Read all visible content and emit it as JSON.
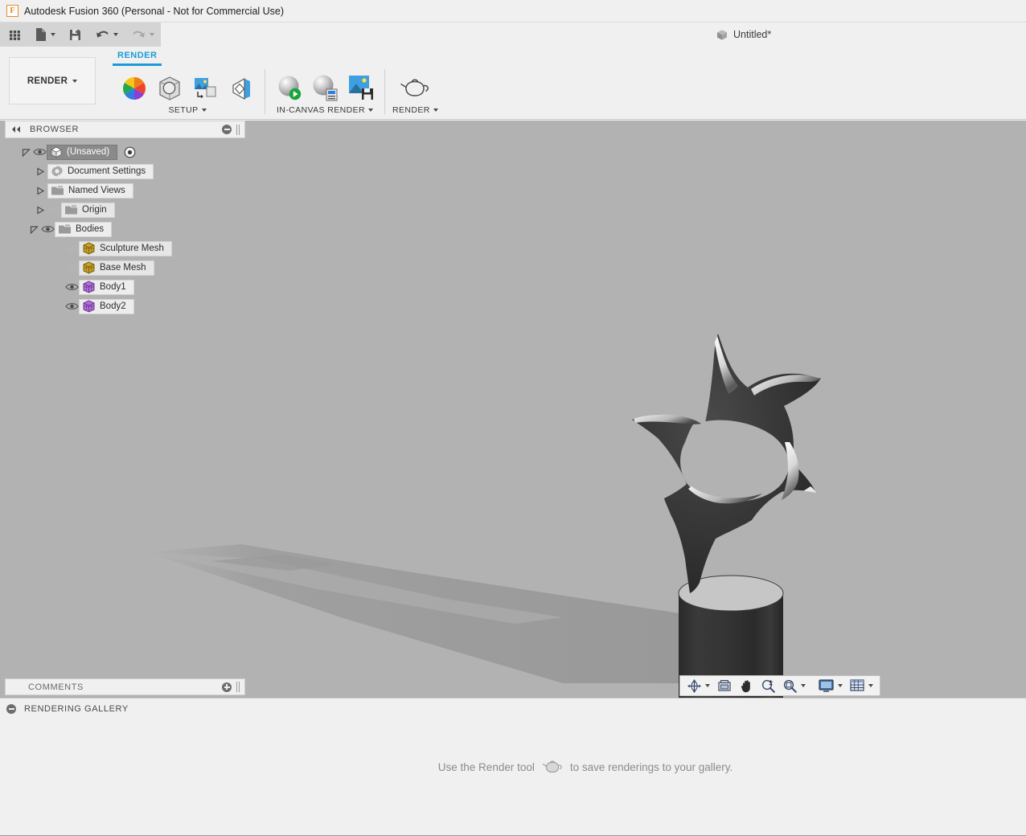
{
  "window": {
    "title": "Autodesk Fusion 360 (Personal - Not for Commercial Use)",
    "logo_letter": "F"
  },
  "quick_access": {
    "items": [
      {
        "name": "show-data-panel",
        "icon": "grid-icon",
        "label": "Show Data Panel",
        "has_caret": false,
        "enabled": true
      },
      {
        "name": "new-design",
        "icon": "file-icon",
        "label": "File",
        "has_caret": true,
        "enabled": true
      },
      {
        "name": "save",
        "icon": "save-icon",
        "label": "Save",
        "has_caret": false,
        "enabled": true
      },
      {
        "name": "undo",
        "icon": "undo-arrow-icon",
        "label": "Undo",
        "has_caret": true,
        "enabled": true
      },
      {
        "name": "redo",
        "icon": "redo-arrow-icon",
        "label": "Redo",
        "has_caret": true,
        "enabled": false
      }
    ]
  },
  "document_tab": {
    "label": "Untitled*",
    "icon": "cube-icon"
  },
  "ribbon": {
    "workspace_selector": "RENDER",
    "active_tab": "RENDER",
    "tabs": [
      "RENDER"
    ],
    "panels": [
      {
        "label": "SETUP",
        "has_caret": true,
        "tools": [
          {
            "name": "appearance",
            "icon": "color-wheel-icon",
            "label": "Appearance"
          },
          {
            "name": "scene-settings",
            "icon": "sphere-in-box-icon",
            "label": "Scene Settings"
          },
          {
            "name": "decal",
            "icon": "image-on-face-icon",
            "label": "Decal"
          },
          {
            "name": "texture-map-controls",
            "icon": "texture-plane-icon",
            "label": "Texture Map Controls"
          }
        ]
      },
      {
        "label": "IN-CANVAS RENDER",
        "has_caret": true,
        "tools": [
          {
            "name": "in-canvas-render",
            "icon": "sphere-play-icon",
            "label": "In-canvas Render"
          },
          {
            "name": "in-canvas-render-settings",
            "icon": "sphere-settings-icon",
            "label": "In-canvas Render Settings"
          },
          {
            "name": "capture-image",
            "icon": "image-save-icon",
            "label": "Capture Image"
          }
        ]
      },
      {
        "label": "RENDER",
        "has_caret": true,
        "tools": [
          {
            "name": "render",
            "icon": "teapot-icon",
            "label": "Render"
          }
        ]
      }
    ]
  },
  "browser": {
    "title": "BROWSER",
    "collapse_icon": "double-left-arrow-icon",
    "panel_button_icon": "minus-circle-icon",
    "tree": [
      {
        "label": "(Unsaved)",
        "icon": "cube-icon",
        "indent": 0,
        "expander": "expanded",
        "visibility": "visible",
        "selected": true,
        "has_target": true
      },
      {
        "label": "Document Settings",
        "icon": "gear-icon",
        "indent": 1,
        "expander": "collapsed",
        "visibility": "none",
        "selected": false,
        "has_target": false
      },
      {
        "label": "Named Views",
        "icon": "folder-icon",
        "indent": 1,
        "expander": "collapsed",
        "visibility": "none",
        "selected": false,
        "has_target": false
      },
      {
        "label": "Origin",
        "icon": "folder-icon",
        "indent": 1,
        "expander": "collapsed",
        "visibility": "hidden",
        "selected": false,
        "has_target": false
      },
      {
        "label": "Bodies",
        "icon": "folder-icon",
        "indent": 1,
        "expander": "expanded",
        "visibility": "visible",
        "selected": false,
        "has_target": false
      },
      {
        "label": "Sculpture Mesh",
        "icon": "mesh-body-icon",
        "indent": 2,
        "expander": "none",
        "visibility": "hidden",
        "selected": false,
        "has_target": false
      },
      {
        "label": "Base Mesh",
        "icon": "mesh-body-icon",
        "indent": 2,
        "expander": "none",
        "visibility": "hidden",
        "selected": false,
        "has_target": false
      },
      {
        "label": "Body1",
        "icon": "solid-body-icon",
        "indent": 2,
        "expander": "none",
        "visibility": "visible",
        "selected": false,
        "has_target": false
      },
      {
        "label": "Body2",
        "icon": "solid-body-icon",
        "indent": 2,
        "expander": "none",
        "visibility": "visible",
        "selected": false,
        "has_target": false
      }
    ]
  },
  "comments": {
    "title": "COMMENTS",
    "panel_button_icon": "plus-circle-icon"
  },
  "navigation_bar": {
    "items": [
      {
        "name": "orbit",
        "icon": "orbit-icon",
        "label": "Orbit",
        "has_caret": true
      },
      {
        "name": "look-at",
        "icon": "look-at-icon",
        "label": "Look At",
        "has_caret": false
      },
      {
        "name": "pan",
        "icon": "hand-icon",
        "label": "Pan",
        "has_caret": false
      },
      {
        "name": "zoom",
        "icon": "magnifier-plusminus-icon",
        "label": "Zoom",
        "has_caret": false
      },
      {
        "name": "zoom-window",
        "icon": "magnifier-window-icon",
        "label": "Fit",
        "has_caret": true
      },
      {
        "name": "display-settings",
        "icon": "monitor-icon",
        "label": "Display Settings",
        "has_caret": true
      },
      {
        "name": "grid-and-snaps",
        "icon": "grid-table-icon",
        "label": "Grid and Snaps",
        "has_caret": true
      }
    ]
  },
  "rendering_gallery": {
    "title": "RENDERING GALLERY",
    "panel_button_icon": "minus-circle-icon",
    "empty_message_before_icon": "Use the Render tool",
    "empty_message_icon": "teapot-icon",
    "empty_message_after_icon": "to save renderings to your gallery."
  },
  "viewport": {
    "background_color": "#b2b2b2",
    "scene_description": "Dark glossy organic star-shaped sculpture with central hole mounted on a dark cylindrical pedestal, casting a long soft shadow to the upper left",
    "objects": [
      {
        "name": "sculpture",
        "color": "#2e2e2e",
        "finish": "glossy"
      },
      {
        "name": "pedestal",
        "color": "#2f2f2f",
        "top_color": "#c6c6c6"
      },
      {
        "name": "shadow",
        "color": "#9a9a9a"
      }
    ]
  },
  "colors": {
    "accent_blue": "#1b9bd8",
    "canvas_grey": "#b2b2b2",
    "panel_grey": "#f0f0f0",
    "toolbar_grey": "#d4d4d4",
    "body_purple": "#b06fd6",
    "mesh_gold": "#c9a227"
  }
}
